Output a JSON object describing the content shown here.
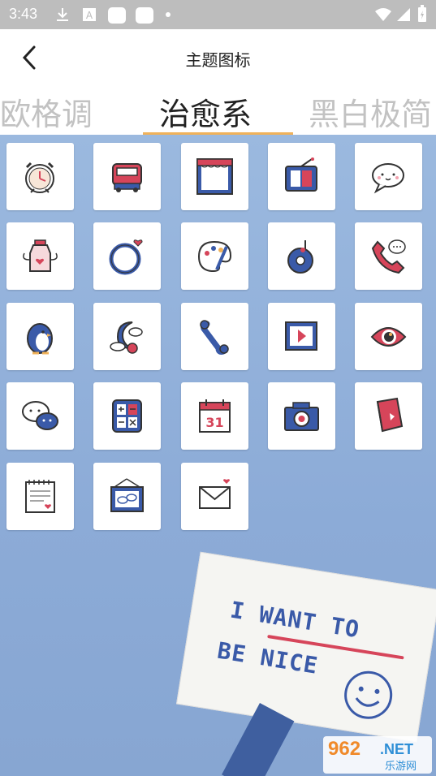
{
  "status_bar": {
    "time": "3:43",
    "icons": [
      "download-icon",
      "a-icon",
      "app-square-icon",
      "app-square-icon",
      "dot-icon",
      "wifi-icon",
      "cellular-icon",
      "battery-icon"
    ]
  },
  "header": {
    "title": "主题图标",
    "tabs": [
      {
        "label": "欧格调",
        "active": false
      },
      {
        "label": "治愈系",
        "active": true
      },
      {
        "label": "黑白极简",
        "active": false
      }
    ],
    "accent": "#f0b25a"
  },
  "icons": [
    {
      "name": "alarm-clock-icon"
    },
    {
      "name": "bus-icon"
    },
    {
      "name": "window-frame-icon"
    },
    {
      "name": "tv-icon"
    },
    {
      "name": "chat-bubble-icon"
    },
    {
      "name": "bottle-wings-icon"
    },
    {
      "name": "ring-icon"
    },
    {
      "name": "palette-icon"
    },
    {
      "name": "music-disc-icon"
    },
    {
      "name": "phone-icon"
    },
    {
      "name": "penguin-icon"
    },
    {
      "name": "moon-cloud-icon"
    },
    {
      "name": "bone-wrench-icon"
    },
    {
      "name": "video-player-icon"
    },
    {
      "name": "eye-icon"
    },
    {
      "name": "chat-faces-icon"
    },
    {
      "name": "calculator-icon"
    },
    {
      "name": "calendar-icon"
    },
    {
      "name": "camera-icon"
    },
    {
      "name": "book-icon"
    },
    {
      "name": "notepad-icon"
    },
    {
      "name": "picture-frame-icon"
    },
    {
      "name": "mail-icon"
    }
  ],
  "calendar_day": "31",
  "sign": {
    "line1": "I WANT TO",
    "line2": "BE NICE"
  },
  "watermark": {
    "num": "962",
    "net": ".NET",
    "cn": "乐游网"
  },
  "colors": {
    "background": "#8eafd9",
    "icon_blue": "#3a5aa8",
    "icon_red": "#d6455a"
  }
}
